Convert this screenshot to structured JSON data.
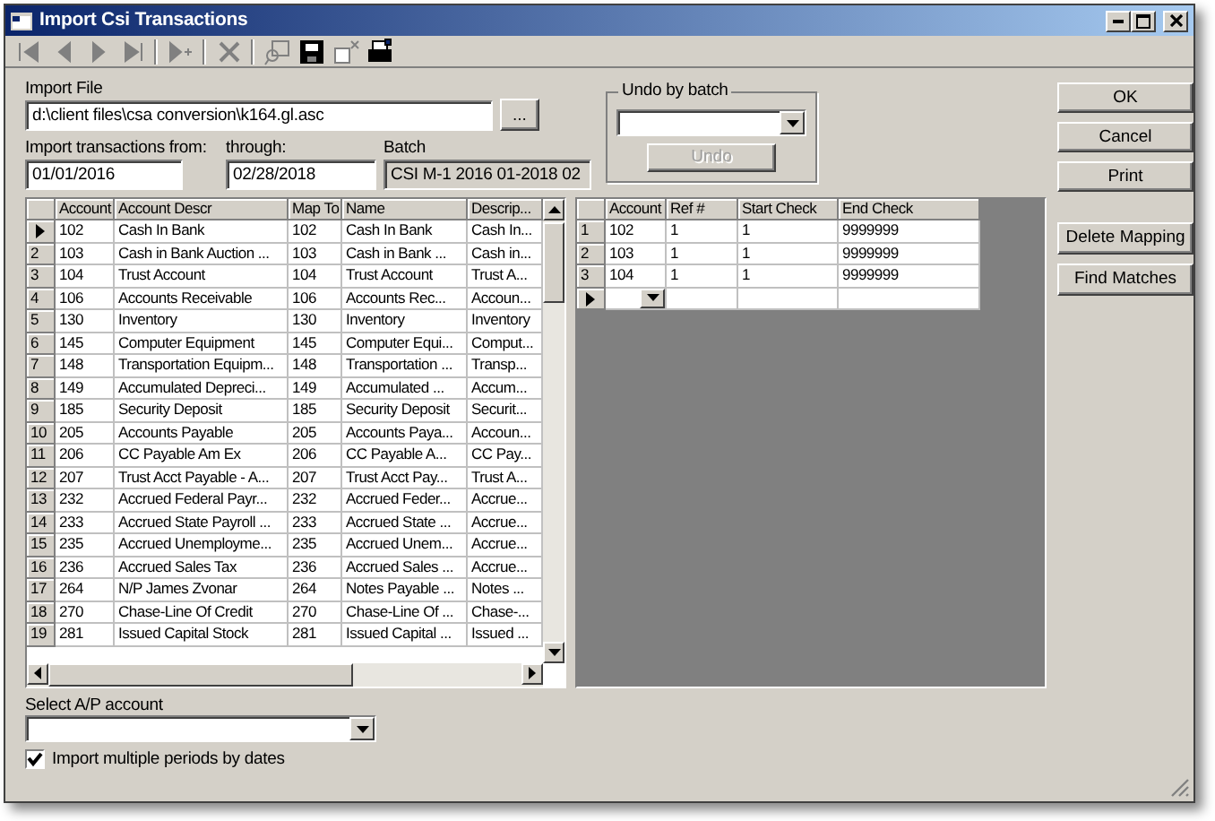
{
  "window": {
    "title": "Import Csi Transactions"
  },
  "toolbar": [
    {
      "kind": "first",
      "disabled": true
    },
    {
      "kind": "prev",
      "disabled": true
    },
    {
      "kind": "next",
      "disabled": true
    },
    {
      "kind": "last",
      "disabled": true
    },
    {
      "kind": "sep"
    },
    {
      "kind": "new",
      "disabled": true
    },
    {
      "kind": "sep"
    },
    {
      "kind": "delete",
      "disabled": true
    },
    {
      "kind": "sep"
    },
    {
      "kind": "find",
      "disabled": true
    },
    {
      "kind": "save",
      "disabled": false
    },
    {
      "kind": "cancel",
      "disabled": true
    },
    {
      "kind": "print",
      "disabled": false
    }
  ],
  "import_file": {
    "label": "Import File",
    "value": "d:\\client files\\csa conversion\\k164.gl.asc",
    "browse": "..."
  },
  "from": {
    "label": "Import transactions from:",
    "value": "01/01/2016"
  },
  "through": {
    "label": "through:",
    "value": "02/28/2018"
  },
  "batch": {
    "label": "Batch",
    "value": "CSI M-1 2016 01-2018 02"
  },
  "undo": {
    "label": "Undo by batch",
    "button": "Undo",
    "disabled": true
  },
  "buttons": [
    "OK",
    "Cancel",
    "Print"
  ],
  "mapping_buttons": [
    "Delete Mapping",
    "Find Matches"
  ],
  "accounts_grid": {
    "columns": [
      "Account",
      "Account Descr",
      "Map To",
      "Name",
      "Descrip..."
    ],
    "rows": [
      {
        "header": "",
        "current": true,
        "cells": [
          "102",
          "Cash In Bank",
          "102",
          "Cash In Bank",
          "Cash In..."
        ]
      },
      {
        "header": "2",
        "current": false,
        "cells": [
          "103",
          "Cash in Bank Auction ...",
          "103",
          "Cash in Bank ...",
          "Cash in..."
        ]
      },
      {
        "header": "3",
        "current": false,
        "cells": [
          "104",
          "Trust Account",
          "104",
          "Trust Account",
          "Trust A..."
        ]
      },
      {
        "header": "4",
        "current": false,
        "cells": [
          "106",
          "Accounts Receivable",
          "106",
          "Accounts Rec...",
          "Accoun..."
        ]
      },
      {
        "header": "5",
        "current": false,
        "cells": [
          "130",
          "Inventory",
          "130",
          "Inventory",
          "Inventory"
        ]
      },
      {
        "header": "6",
        "current": false,
        "cells": [
          "145",
          "Computer Equipment",
          "145",
          "Computer Equi...",
          "Comput..."
        ]
      },
      {
        "header": "7",
        "current": false,
        "cells": [
          "148",
          "Transportation Equipm...",
          "148",
          "Transportation ...",
          "Transp..."
        ]
      },
      {
        "header": "8",
        "current": false,
        "cells": [
          "149",
          "Accumulated Depreci...",
          "149",
          "Accumulated ...",
          "Accum..."
        ]
      },
      {
        "header": "9",
        "current": false,
        "cells": [
          "185",
          "Security Deposit",
          "185",
          "Security Deposit",
          "Securit..."
        ]
      },
      {
        "header": "10",
        "current": false,
        "cells": [
          "205",
          "Accounts Payable",
          "205",
          "Accounts Paya...",
          "Accoun..."
        ]
      },
      {
        "header": "11",
        "current": false,
        "cells": [
          "206",
          "CC Payable Am Ex",
          "206",
          "CC Payable A...",
          "CC Pay..."
        ]
      },
      {
        "header": "12",
        "current": false,
        "cells": [
          "207",
          "Trust Acct Payable - A...",
          "207",
          "Trust Acct Pay...",
          "Trust A..."
        ]
      },
      {
        "header": "13",
        "current": false,
        "cells": [
          "232",
          "Accrued Federal Payr...",
          "232",
          "Accrued Feder...",
          "Accrue..."
        ]
      },
      {
        "header": "14",
        "current": false,
        "cells": [
          "233",
          "Accrued State Payroll ...",
          "233",
          "Accrued State ...",
          "Accrue..."
        ]
      },
      {
        "header": "15",
        "current": false,
        "cells": [
          "235",
          "Accrued Unemployme...",
          "235",
          "Accrued Unem...",
          "Accrue..."
        ]
      },
      {
        "header": "16",
        "current": false,
        "cells": [
          "236",
          "Accrued Sales Tax",
          "236",
          "Accrued Sales ...",
          "Accrue..."
        ]
      },
      {
        "header": "17",
        "current": false,
        "cells": [
          "264",
          "N/P James Zvonar",
          "264",
          "Notes Payable ...",
          "Notes ..."
        ]
      },
      {
        "header": "18",
        "current": false,
        "cells": [
          "270",
          "Chase-Line Of Credit",
          "270",
          "Chase-Line Of ...",
          "Chase-..."
        ]
      },
      {
        "header": "19",
        "current": false,
        "cells": [
          "281",
          "Issued Capital Stock",
          "281",
          "Issued Capital ...",
          "Issued ..."
        ]
      }
    ]
  },
  "checks_grid": {
    "columns": [
      "Account",
      "Ref #",
      "Start Check",
      "End Check"
    ],
    "rows": [
      {
        "header": "1",
        "current": false,
        "cells": [
          "102",
          "1",
          "1",
          "9999999"
        ]
      },
      {
        "header": "2",
        "current": false,
        "cells": [
          "103",
          "1",
          "1",
          "9999999"
        ]
      },
      {
        "header": "3",
        "current": false,
        "cells": [
          "104",
          "1",
          "1",
          "9999999"
        ]
      },
      {
        "header": "",
        "current": true,
        "cells": [
          "",
          "",
          "",
          ""
        ]
      }
    ]
  },
  "ap_account": {
    "label": "Select A/P account"
  },
  "multi_period": {
    "label": "Import multiple periods by dates",
    "checked": true
  }
}
